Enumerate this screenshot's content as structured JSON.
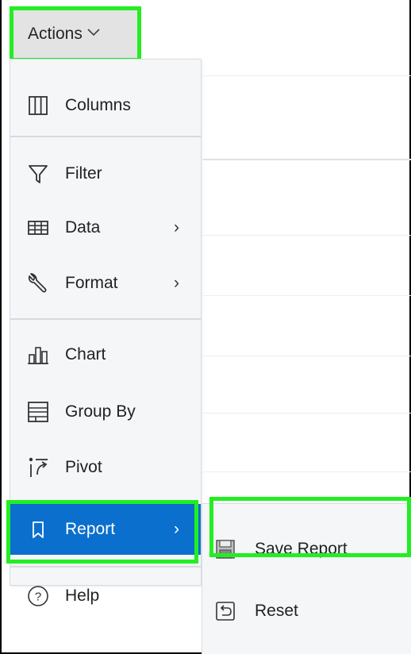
{
  "actions_button": {
    "label": "Actions",
    "chevron_icon": "chevron-down-icon"
  },
  "menu": {
    "items": [
      {
        "label": "Columns",
        "icon": "columns-icon"
      },
      {
        "label": "Filter",
        "icon": "filter-icon"
      },
      {
        "label": "Data",
        "icon": "table-icon",
        "arrow": "›"
      },
      {
        "label": "Format",
        "icon": "wrench-icon",
        "arrow": "›"
      },
      {
        "label": "Chart",
        "icon": "bar-chart-icon"
      },
      {
        "label": "Group By",
        "icon": "group-by-icon"
      },
      {
        "label": "Pivot",
        "icon": "pivot-icon"
      },
      {
        "label": "Report",
        "icon": "bookmark-icon",
        "arrow": "›"
      },
      {
        "label": "Help",
        "icon": "help-icon"
      }
    ]
  },
  "submenu": {
    "items": [
      {
        "label": "Save Report",
        "icon": "save-icon"
      },
      {
        "label": "Reset",
        "icon": "reset-icon"
      }
    ]
  },
  "colors": {
    "active_bg": "#0b6fce",
    "highlight_outline": "#22ee22",
    "menu_bg": "#f5f6f8"
  }
}
